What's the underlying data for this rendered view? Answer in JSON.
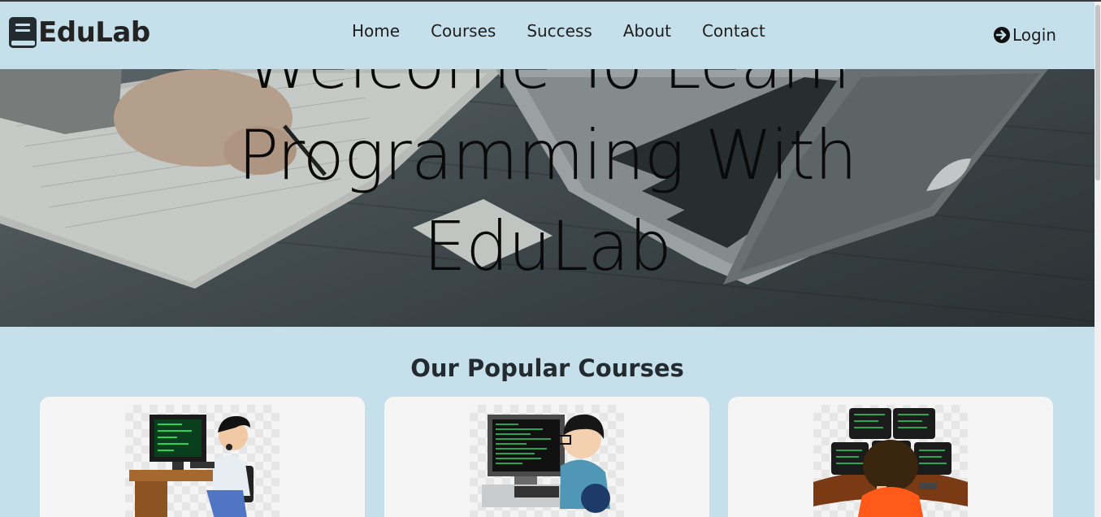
{
  "brand": {
    "name": "EduLab",
    "icon": "book-icon"
  },
  "nav": {
    "links": [
      "Home",
      "Courses",
      "Success",
      "About",
      "Contact"
    ],
    "login_label": "Login",
    "login_icon": "arrow-circle-right-icon"
  },
  "hero": {
    "title_line1": "Welcome To Learn",
    "title_line2": "Programming With",
    "title_line3": "EduLab"
  },
  "courses": {
    "heading": "Our Popular Courses",
    "cards": [
      {
        "image": "programmer-with-headset-illustration"
      },
      {
        "image": "programmer-at-monitor-illustration"
      },
      {
        "image": "programmer-multiple-monitors-illustration"
      }
    ]
  },
  "colors": {
    "page_background": "#c5e0ea",
    "card_background": "#f5f5f5",
    "text_dark": "#232323"
  }
}
